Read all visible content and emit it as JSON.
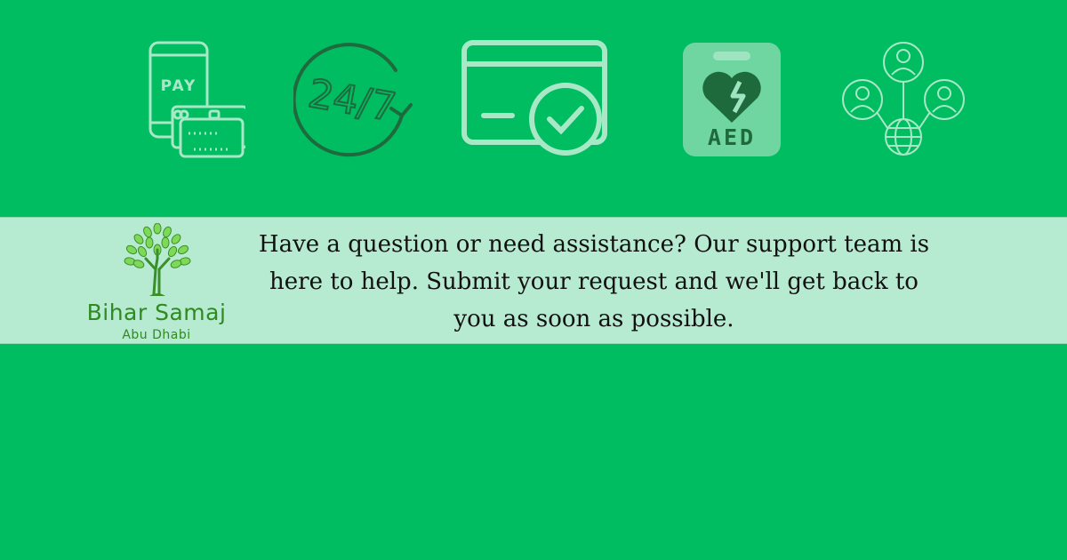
{
  "icons": [
    {
      "name": "mobile-pay-icon",
      "label": "PAY"
    },
    {
      "name": "support-24-7-icon",
      "label": "24/7"
    },
    {
      "name": "card-verified-icon"
    },
    {
      "name": "aed-icon",
      "label": "AED"
    },
    {
      "name": "network-people-icon"
    }
  ],
  "logo": {
    "name": "Bihar Samaj",
    "subtitle": "Abu Dhabi"
  },
  "message": "Have a question or need assistance? Our support team is here to help. Submit your request and we'll get back to you as soon as possible.",
  "colors": {
    "background": "#00bd62",
    "band": "#b6ead1",
    "icon_stroke": "#a9e8c6",
    "logo_green": "#2f8a1f"
  }
}
